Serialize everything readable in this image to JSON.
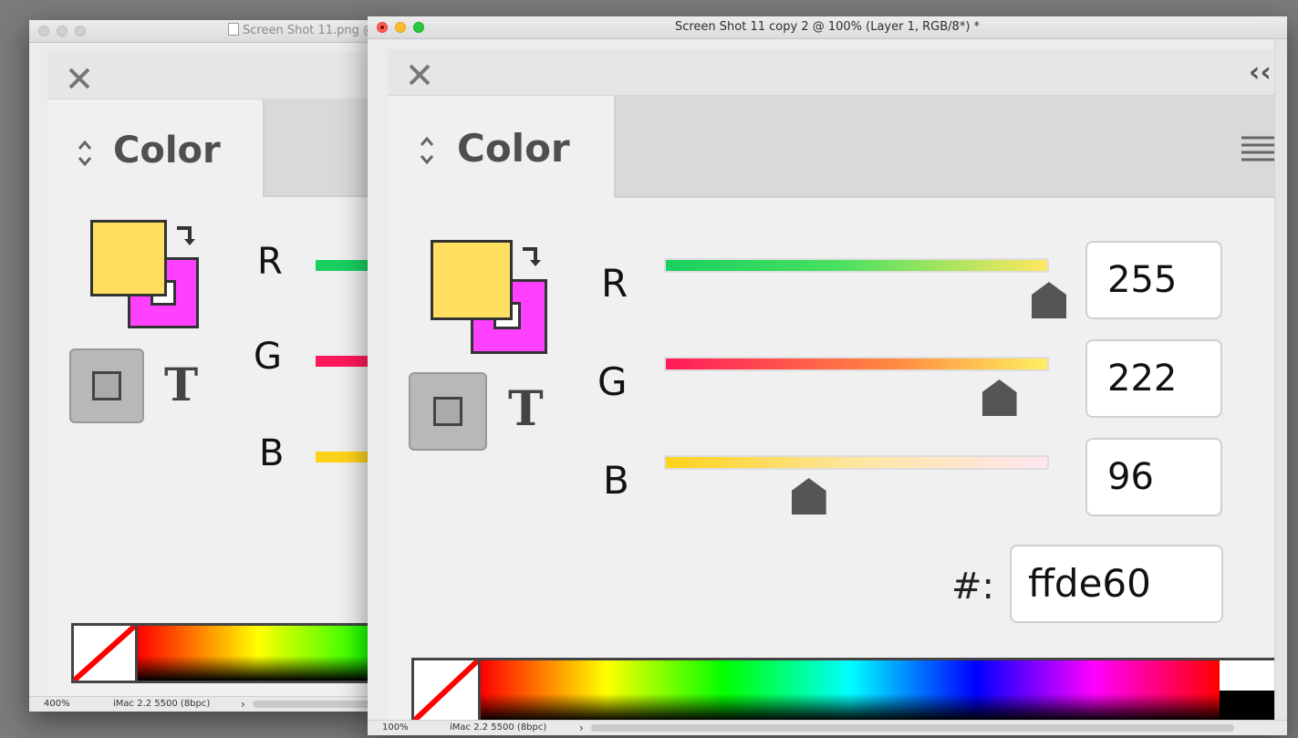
{
  "back_window": {
    "title": "Screen Shot 11.png @",
    "panel": {
      "tab_label": "Color",
      "channels": [
        "R",
        "G",
        "B"
      ],
      "fill_color": "#ffde60",
      "stroke_color": "#ff40ff",
      "text_toggle": "T"
    },
    "status": {
      "zoom": "400%",
      "profile": "iMac 2.2 5500 (8bpc)",
      "arrow": "›"
    }
  },
  "front_window": {
    "title": "Screen Shot 11 copy 2 @ 100% (Layer 1, RGB/8*) *",
    "panel": {
      "tab_label": "Color",
      "collapse_glyph": "‹‹",
      "fill_color": "#ffde60",
      "stroke_color": "#ff40ff",
      "text_toggle": "T",
      "channels": [
        {
          "label": "R",
          "value": "255",
          "fraction": 1.0
        },
        {
          "label": "G",
          "value": "222",
          "fraction": 0.871
        },
        {
          "label": "B",
          "value": "96",
          "fraction": 0.376
        }
      ],
      "hex_label": "#:",
      "hex_value": "ffde60"
    },
    "status": {
      "zoom": "100%",
      "profile": "iMac 2.2 5500 (8bpc)",
      "arrow": "›"
    }
  }
}
